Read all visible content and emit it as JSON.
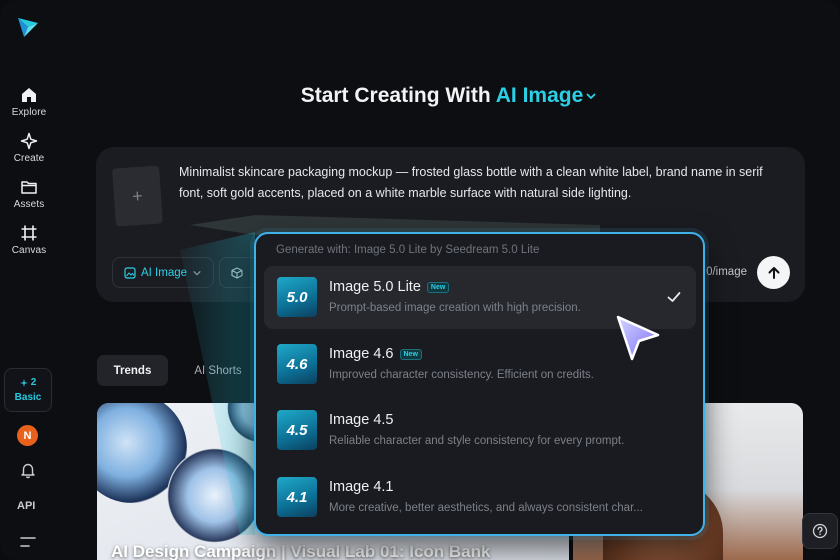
{
  "sidebar": {
    "items": [
      {
        "label": "Explore",
        "icon": "home-icon"
      },
      {
        "label": "Create",
        "icon": "sparkle-icon"
      },
      {
        "label": "Assets",
        "icon": "folder-icon"
      },
      {
        "label": "Canvas",
        "icon": "canvas-icon"
      }
    ],
    "credits": "2",
    "plan": "Basic",
    "avatar_initial": "N",
    "api_label": "API"
  },
  "headline": {
    "prefix": "Start Creating With",
    "accent": "AI Image"
  },
  "prompt": {
    "text": "Minimalist skincare packaging mockup — frosted glass bottle with a clean white label, brand name in serif font, soft gold accents, placed on a white marble surface with natural side lighting.",
    "mode_label": "AI Image",
    "cost_suffix": "0/image"
  },
  "tabs": [
    {
      "label": "Trends"
    },
    {
      "label": "AI Shorts"
    }
  ],
  "gallery": {
    "card1_title": "AI Design Campaign | Visual Lab 01: Icon Bank"
  },
  "model_dropdown": {
    "header": "Generate with: Image 5.0 Lite by Seedream 5.0 Lite",
    "badge_new": "New",
    "options": [
      {
        "name": "Image 5.0 Lite",
        "thumb": "5.0",
        "desc": "Prompt-based image creation with high precision.",
        "is_new": true,
        "selected": true
      },
      {
        "name": "Image 4.6",
        "thumb": "4.6",
        "desc": "Improved character consistency. Efficient on credits.",
        "is_new": true,
        "selected": false
      },
      {
        "name": "Image 4.5",
        "thumb": "4.5",
        "desc": "Reliable character and style consistency for every prompt.",
        "is_new": false,
        "selected": false
      },
      {
        "name": "Image 4.1",
        "thumb": "4.1",
        "desc": "More creative, better aesthetics, and always consistent char...",
        "is_new": false,
        "selected": false
      }
    ]
  },
  "colors": {
    "accent": "#2bd0e6",
    "dropdown_border": "#3fb2e8",
    "background": "#0d0e11",
    "card": "#1b1c21"
  }
}
